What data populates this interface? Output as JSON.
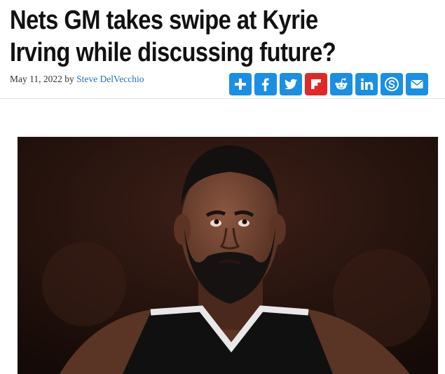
{
  "article": {
    "title": "Nets GM takes swipe at Kyrie Irving while discussing future?",
    "date": "May 11, 2022",
    "by": "by",
    "author": "Steve DelVecchio"
  },
  "share": {
    "buttons": [
      {
        "name": "addtoany",
        "icon": "plus-icon",
        "color": "#1a8fe3"
      },
      {
        "name": "facebook",
        "icon": "facebook-icon",
        "color": "#1a8fe3"
      },
      {
        "name": "twitter",
        "icon": "twitter-icon",
        "color": "#1a8fe3"
      },
      {
        "name": "flipboard",
        "icon": "flipboard-icon",
        "color": "#e12828"
      },
      {
        "name": "reddit",
        "icon": "reddit-icon",
        "color": "#1a8fe3"
      },
      {
        "name": "linkedin",
        "icon": "linkedin-icon",
        "color": "#1a8fe3"
      },
      {
        "name": "skype",
        "icon": "skype-icon",
        "color": "#1a8fe3"
      },
      {
        "name": "email",
        "icon": "email-icon",
        "color": "#1a8fe3"
      }
    ]
  },
  "image": {
    "icon": "player-photo"
  }
}
